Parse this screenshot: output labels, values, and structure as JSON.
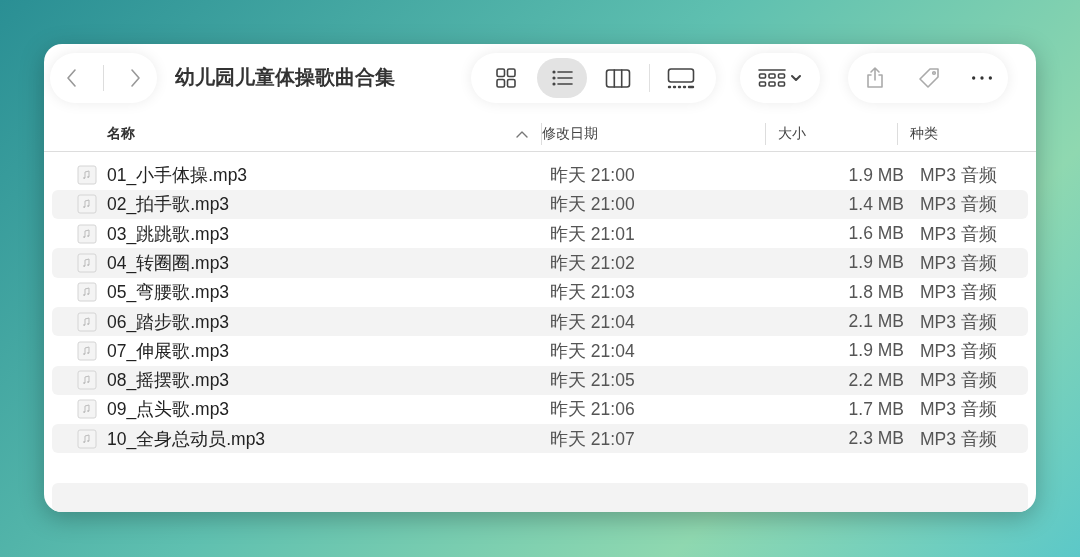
{
  "window": {
    "title": "幼儿园儿童体操歌曲合集"
  },
  "view_modes": [
    {
      "kind": "icons",
      "selected": false
    },
    {
      "kind": "list",
      "selected": true
    },
    {
      "kind": "columns",
      "selected": false
    },
    {
      "kind": "gallery",
      "selected": false
    }
  ],
  "columns": [
    {
      "label": "名称",
      "sorted": true
    },
    {
      "label": "修改日期",
      "sorted": false
    },
    {
      "label": "大小",
      "sorted": false
    },
    {
      "label": "种类",
      "sorted": false
    }
  ],
  "rows": [
    {
      "name": "01_小手体操.mp3",
      "date": "昨天 21:00",
      "size": "1.9 MB",
      "kind": "MP3 音频"
    },
    {
      "name": "02_拍手歌.mp3",
      "date": "昨天 21:00",
      "size": "1.4 MB",
      "kind": "MP3 音频"
    },
    {
      "name": "03_跳跳歌.mp3",
      "date": "昨天 21:01",
      "size": "1.6 MB",
      "kind": "MP3 音频"
    },
    {
      "name": "04_转圈圈.mp3",
      "date": "昨天 21:02",
      "size": "1.9 MB",
      "kind": "MP3 音频"
    },
    {
      "name": "05_弯腰歌.mp3",
      "date": "昨天 21:03",
      "size": "1.8 MB",
      "kind": "MP3 音频"
    },
    {
      "name": "06_踏步歌.mp3",
      "date": "昨天 21:04",
      "size": "2.1 MB",
      "kind": "MP3 音频"
    },
    {
      "name": "07_伸展歌.mp3",
      "date": "昨天 21:04",
      "size": "1.9 MB",
      "kind": "MP3 音频"
    },
    {
      "name": "08_摇摆歌.mp3",
      "date": "昨天 21:05",
      "size": "2.2 MB",
      "kind": "MP3 音频"
    },
    {
      "name": "09_点头歌.mp3",
      "date": "昨天 21:06",
      "size": "1.7 MB",
      "kind": "MP3 音频"
    },
    {
      "name": "10_全身总动员.mp3",
      "date": "昨天 21:07",
      "size": "2.3 MB",
      "kind": "MP3 音频"
    }
  ]
}
